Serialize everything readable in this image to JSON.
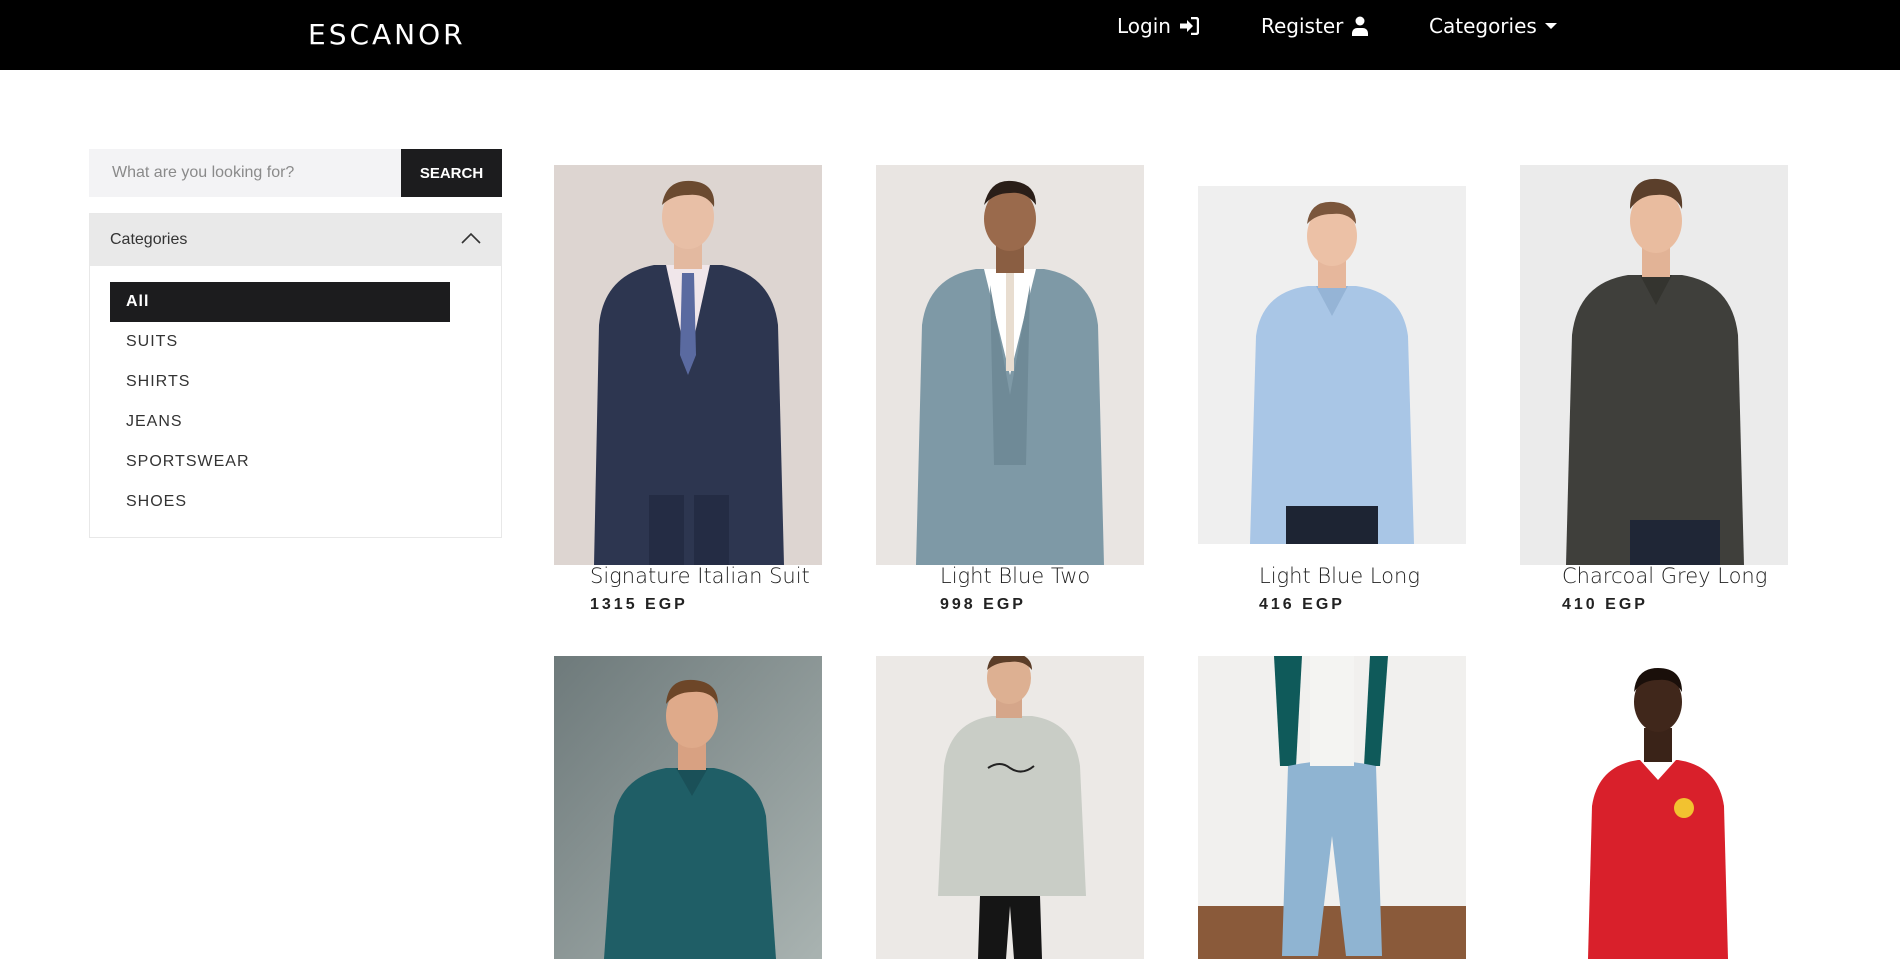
{
  "navbar": {
    "brand": "ESCANOR",
    "login": "Login",
    "register": "Register",
    "categories": "Categories"
  },
  "search": {
    "placeholder": "What are you looking for?",
    "button": "SEARCH"
  },
  "sidebar": {
    "header": "Categories",
    "items": [
      {
        "label": "All",
        "active": true
      },
      {
        "label": "SUITS"
      },
      {
        "label": "SHIRTS"
      },
      {
        "label": "JEANS"
      },
      {
        "label": "SPORTSWEAR"
      },
      {
        "label": "SHOES"
      }
    ]
  },
  "products": [
    {
      "name": "Signature Italian Suit",
      "price": "1315 EGP"
    },
    {
      "name": "Light Blue Two",
      "price": "998 EGP"
    },
    {
      "name": "Light Blue Long",
      "price": "416 EGP"
    },
    {
      "name": "Charcoal Grey Long",
      "price": "410 EGP"
    },
    {
      "name": "",
      "price": ""
    },
    {
      "name": "",
      "price": ""
    },
    {
      "name": "",
      "price": ""
    },
    {
      "name": "",
      "price": ""
    }
  ]
}
